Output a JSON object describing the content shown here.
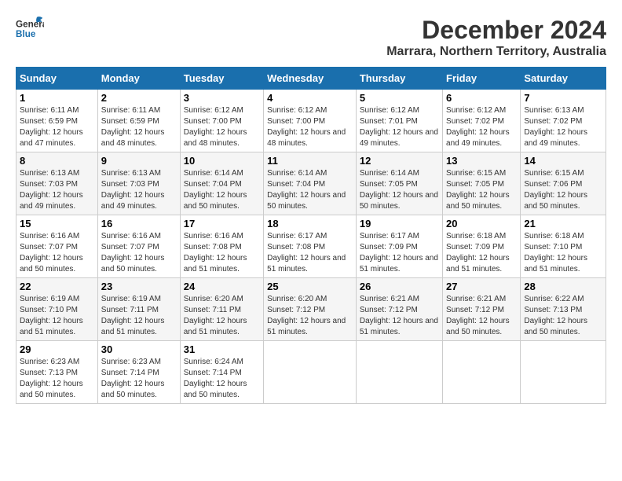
{
  "logo": {
    "line1": "General",
    "line2": "Blue"
  },
  "title": "December 2024",
  "subtitle": "Marrara, Northern Territory, Australia",
  "days_of_week": [
    "Sunday",
    "Monday",
    "Tuesday",
    "Wednesday",
    "Thursday",
    "Friday",
    "Saturday"
  ],
  "weeks": [
    [
      {
        "day": "1",
        "sunrise": "6:11 AM",
        "sunset": "6:59 PM",
        "daylight": "12 hours and 47 minutes."
      },
      {
        "day": "2",
        "sunrise": "6:11 AM",
        "sunset": "6:59 PM",
        "daylight": "12 hours and 48 minutes."
      },
      {
        "day": "3",
        "sunrise": "6:12 AM",
        "sunset": "7:00 PM",
        "daylight": "12 hours and 48 minutes."
      },
      {
        "day": "4",
        "sunrise": "6:12 AM",
        "sunset": "7:00 PM",
        "daylight": "12 hours and 48 minutes."
      },
      {
        "day": "5",
        "sunrise": "6:12 AM",
        "sunset": "7:01 PM",
        "daylight": "12 hours and 49 minutes."
      },
      {
        "day": "6",
        "sunrise": "6:12 AM",
        "sunset": "7:02 PM",
        "daylight": "12 hours and 49 minutes."
      },
      {
        "day": "7",
        "sunrise": "6:13 AM",
        "sunset": "7:02 PM",
        "daylight": "12 hours and 49 minutes."
      }
    ],
    [
      {
        "day": "8",
        "sunrise": "6:13 AM",
        "sunset": "7:03 PM",
        "daylight": "12 hours and 49 minutes."
      },
      {
        "day": "9",
        "sunrise": "6:13 AM",
        "sunset": "7:03 PM",
        "daylight": "12 hours and 49 minutes."
      },
      {
        "day": "10",
        "sunrise": "6:14 AM",
        "sunset": "7:04 PM",
        "daylight": "12 hours and 50 minutes."
      },
      {
        "day": "11",
        "sunrise": "6:14 AM",
        "sunset": "7:04 PM",
        "daylight": "12 hours and 50 minutes."
      },
      {
        "day": "12",
        "sunrise": "6:14 AM",
        "sunset": "7:05 PM",
        "daylight": "12 hours and 50 minutes."
      },
      {
        "day": "13",
        "sunrise": "6:15 AM",
        "sunset": "7:05 PM",
        "daylight": "12 hours and 50 minutes."
      },
      {
        "day": "14",
        "sunrise": "6:15 AM",
        "sunset": "7:06 PM",
        "daylight": "12 hours and 50 minutes."
      }
    ],
    [
      {
        "day": "15",
        "sunrise": "6:16 AM",
        "sunset": "7:07 PM",
        "daylight": "12 hours and 50 minutes."
      },
      {
        "day": "16",
        "sunrise": "6:16 AM",
        "sunset": "7:07 PM",
        "daylight": "12 hours and 50 minutes."
      },
      {
        "day": "17",
        "sunrise": "6:16 AM",
        "sunset": "7:08 PM",
        "daylight": "12 hours and 51 minutes."
      },
      {
        "day": "18",
        "sunrise": "6:17 AM",
        "sunset": "7:08 PM",
        "daylight": "12 hours and 51 minutes."
      },
      {
        "day": "19",
        "sunrise": "6:17 AM",
        "sunset": "7:09 PM",
        "daylight": "12 hours and 51 minutes."
      },
      {
        "day": "20",
        "sunrise": "6:18 AM",
        "sunset": "7:09 PM",
        "daylight": "12 hours and 51 minutes."
      },
      {
        "day": "21",
        "sunrise": "6:18 AM",
        "sunset": "7:10 PM",
        "daylight": "12 hours and 51 minutes."
      }
    ],
    [
      {
        "day": "22",
        "sunrise": "6:19 AM",
        "sunset": "7:10 PM",
        "daylight": "12 hours and 51 minutes."
      },
      {
        "day": "23",
        "sunrise": "6:19 AM",
        "sunset": "7:11 PM",
        "daylight": "12 hours and 51 minutes."
      },
      {
        "day": "24",
        "sunrise": "6:20 AM",
        "sunset": "7:11 PM",
        "daylight": "12 hours and 51 minutes."
      },
      {
        "day": "25",
        "sunrise": "6:20 AM",
        "sunset": "7:12 PM",
        "daylight": "12 hours and 51 minutes."
      },
      {
        "day": "26",
        "sunrise": "6:21 AM",
        "sunset": "7:12 PM",
        "daylight": "12 hours and 51 minutes."
      },
      {
        "day": "27",
        "sunrise": "6:21 AM",
        "sunset": "7:12 PM",
        "daylight": "12 hours and 50 minutes."
      },
      {
        "day": "28",
        "sunrise": "6:22 AM",
        "sunset": "7:13 PM",
        "daylight": "12 hours and 50 minutes."
      }
    ],
    [
      {
        "day": "29",
        "sunrise": "6:23 AM",
        "sunset": "7:13 PM",
        "daylight": "12 hours and 50 minutes."
      },
      {
        "day": "30",
        "sunrise": "6:23 AM",
        "sunset": "7:14 PM",
        "daylight": "12 hours and 50 minutes."
      },
      {
        "day": "31",
        "sunrise": "6:24 AM",
        "sunset": "7:14 PM",
        "daylight": "12 hours and 50 minutes."
      },
      null,
      null,
      null,
      null
    ]
  ],
  "labels": {
    "sunrise": "Sunrise:",
    "sunset": "Sunset:",
    "daylight": "Daylight:"
  },
  "accent_color": "#1a6fad"
}
